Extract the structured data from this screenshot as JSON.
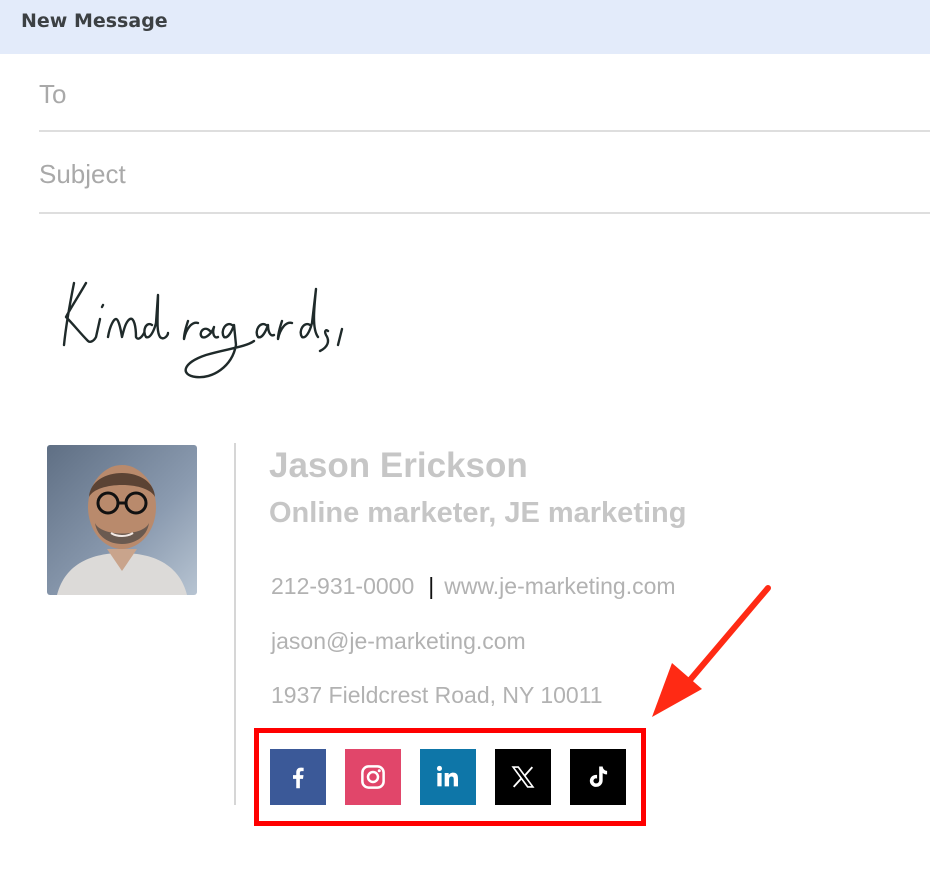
{
  "window": {
    "title": "New Message"
  },
  "compose": {
    "to_placeholder": "To",
    "subject_placeholder": "Subject"
  },
  "signature": {
    "signoff": "Kind regards,",
    "name": "Jason Erickson",
    "role": "Online marketer, JE marketing",
    "phone": "212-931-0000",
    "separator": "|",
    "website": "www.je-marketing.com",
    "email": "jason@je-marketing.com",
    "address": "1937 Fieldcrest Road, NY 10011"
  },
  "social_icons": [
    "facebook-icon",
    "instagram-icon",
    "linkedin-icon",
    "x-icon",
    "tiktok-icon"
  ],
  "colors": {
    "facebook": "#3b5998",
    "instagram": "#e1466a",
    "linkedin": "#0e76a8",
    "x": "#000000",
    "tiktok": "#000000",
    "highlight": "#ff0000"
  }
}
